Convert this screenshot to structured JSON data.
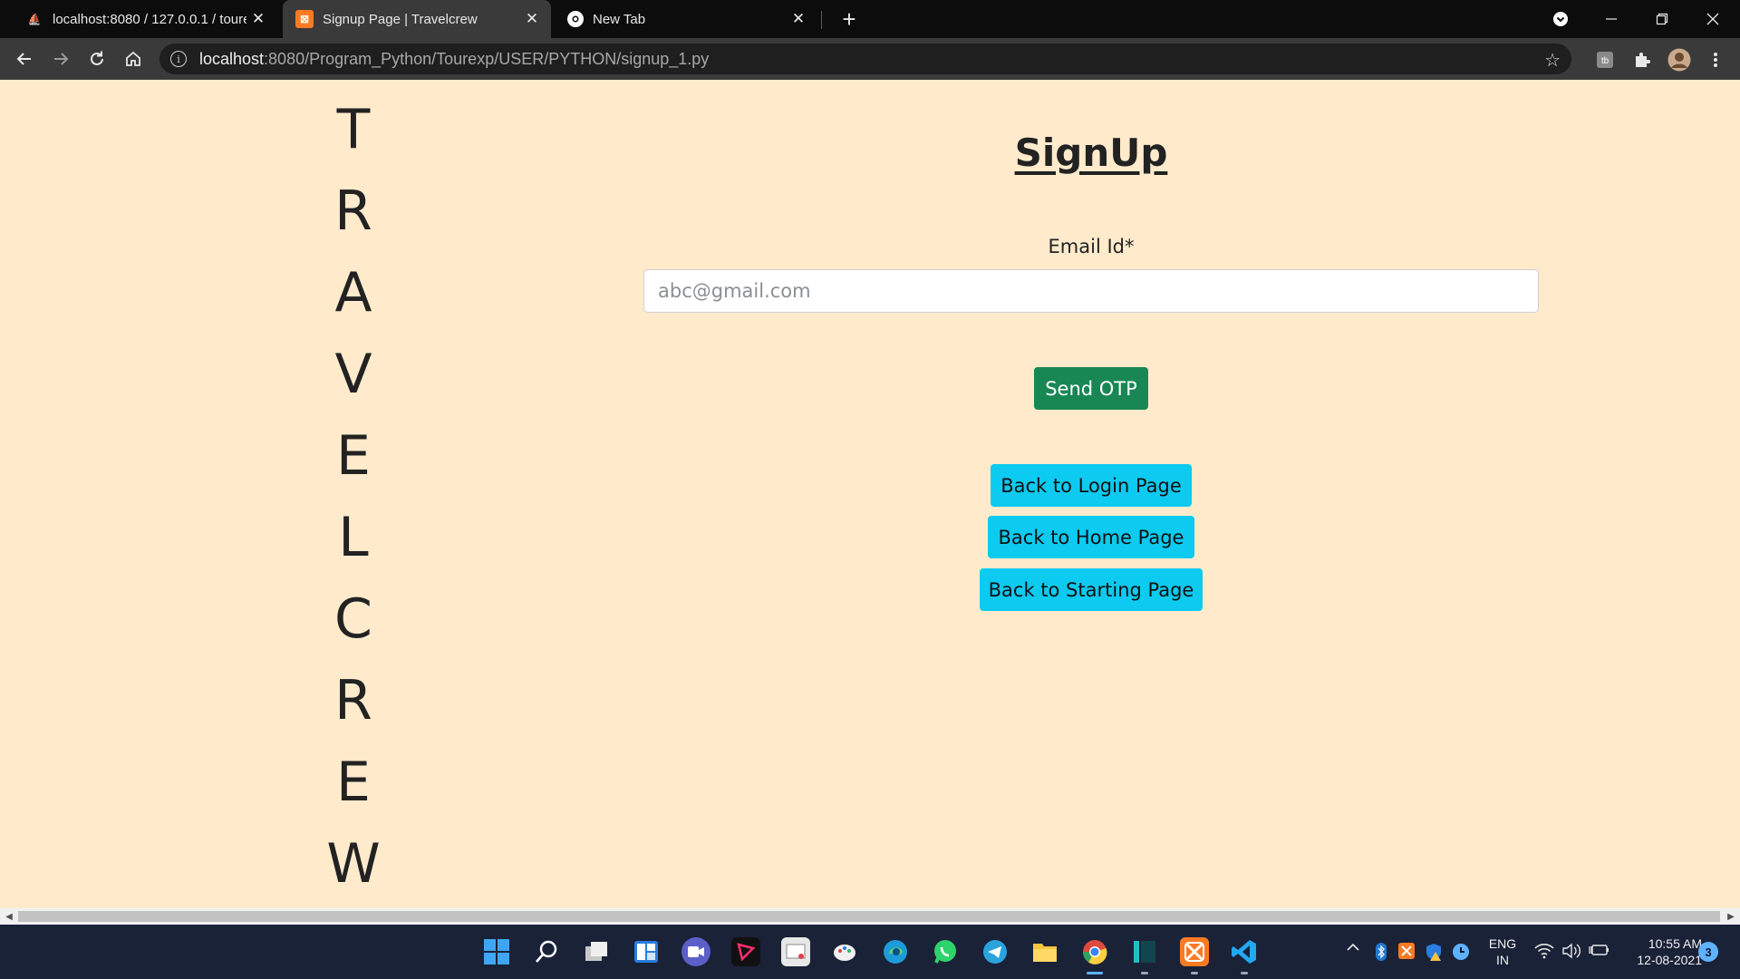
{
  "browser": {
    "tabs": [
      {
        "title": "localhost:8080 / 127.0.0.1 / toure",
        "favicon": "phpmyadmin-icon",
        "active": false
      },
      {
        "title": "Signup Page | Travelcrew",
        "favicon": "xampp-icon",
        "active": true
      },
      {
        "title": "New Tab",
        "favicon": "chrome-icon",
        "active": false
      }
    ],
    "new_tab_label": "+",
    "address": {
      "host": "localhost",
      "path": ":8080/Program_Python/Tourexp/USER/PYTHON/signup_1.py"
    }
  },
  "page": {
    "brand_letters": [
      "T",
      "R",
      "A",
      "V",
      "E",
      "L",
      "C",
      "R",
      "E",
      "W"
    ],
    "title": "SignUp",
    "email_label": "Email Id*",
    "email_placeholder": "abc@gmail.com",
    "email_value": "",
    "buttons": {
      "send_otp": "Send OTP",
      "back_login": "Back to Login Page",
      "back_home": "Back to Home Page",
      "back_start": "Back to Starting Page"
    },
    "colors": {
      "background": "#ffebcc",
      "send_otp": "#198754",
      "nav_buttons": "#0dcaf0"
    }
  },
  "taskbar": {
    "apps": [
      "start-icon",
      "search-icon",
      "task-view-icon",
      "widgets-icon",
      "teams-chat-icon",
      "app-icon",
      "snipping-icon",
      "paint-icon",
      "edge-icon",
      "whatsapp-icon",
      "telegram-icon",
      "file-explorer-icon",
      "chrome-icon",
      "app-icon",
      "xampp-icon",
      "vscode-icon"
    ],
    "language": {
      "line1": "ENG",
      "line2": "IN"
    },
    "time": "10:55 AM",
    "date": "12-08-2021",
    "notifications": "3"
  }
}
